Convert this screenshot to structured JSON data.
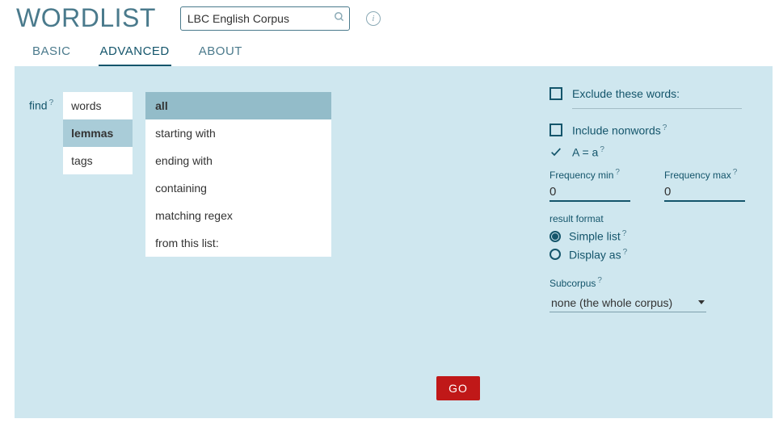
{
  "header": {
    "title": "WORDLIST",
    "corpus": "LBC English Corpus"
  },
  "tabs": [
    "BASIC",
    "ADVANCED",
    "ABOUT"
  ],
  "active_tab": "ADVANCED",
  "find_label": "find",
  "find_groups": [
    "words",
    "lemmas",
    "tags"
  ],
  "find_group_selected": "lemmas",
  "filter_options": [
    "all",
    "starting with",
    "ending with",
    "containing",
    "matching regex",
    "from this list:"
  ],
  "filter_selected": "all",
  "options": {
    "exclude_label": "Exclude these words:",
    "exclude_checked": false,
    "nonwords_label": "Include nonwords",
    "nonwords_checked": false,
    "case_label": "A = a",
    "case_checked": true,
    "freq_min_label": "Frequency min",
    "freq_min_value": "0",
    "freq_max_label": "Frequency max",
    "freq_max_value": "0",
    "result_format_label": "result format",
    "result_format_options": [
      "Simple list",
      "Display as"
    ],
    "result_format_selected": "Simple list",
    "subcorpus_label": "Subcorpus",
    "subcorpus_value": "none (the whole corpus)"
  },
  "go_label": "GO"
}
